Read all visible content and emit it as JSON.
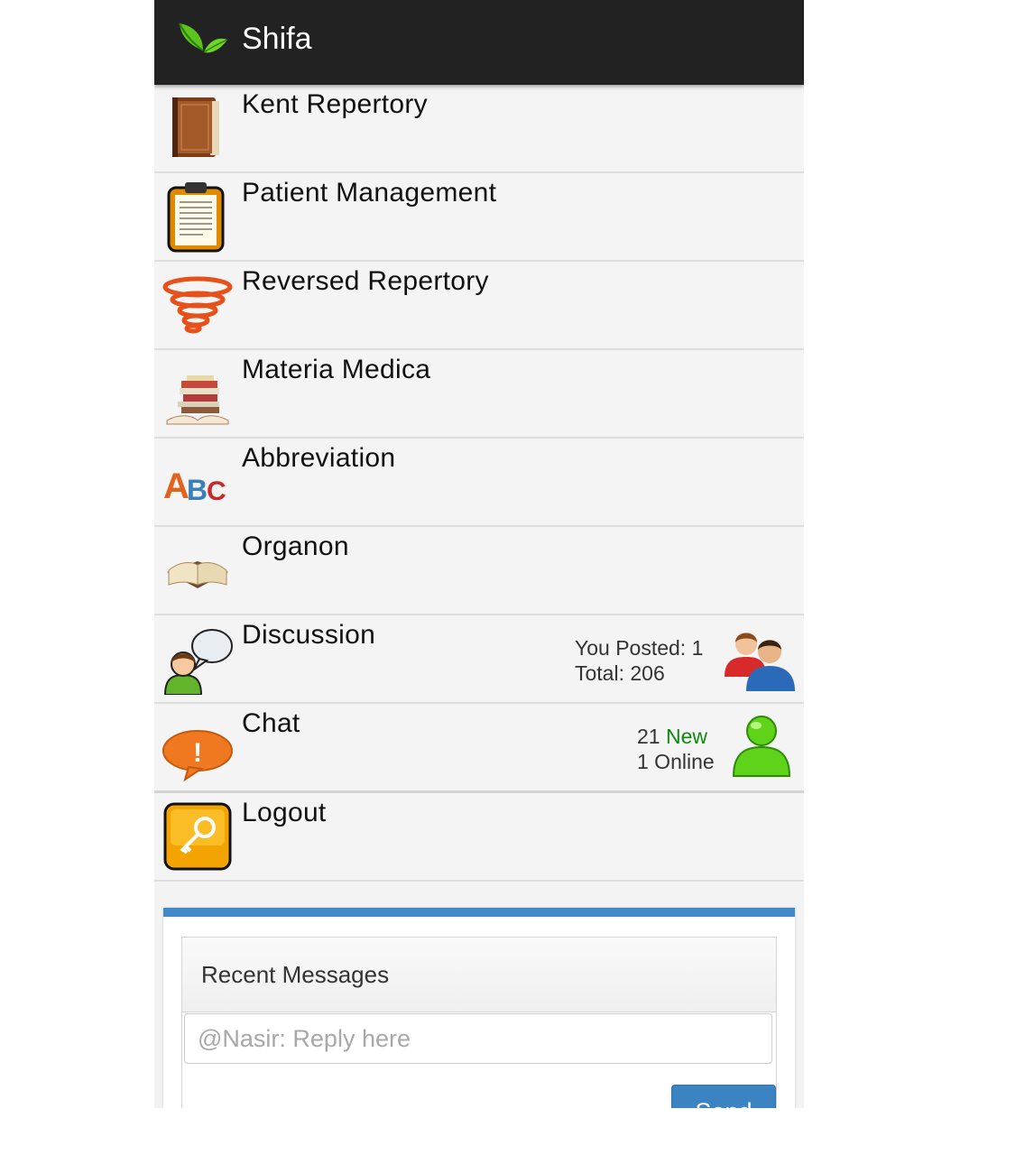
{
  "app": {
    "title": "Shifa"
  },
  "menu": {
    "items": [
      {
        "label": "Kent Repertory",
        "icon": "book-icon"
      },
      {
        "label": "Patient Management",
        "icon": "clipboard-icon"
      },
      {
        "label": "Reversed Repertory",
        "icon": "tornado-icon"
      },
      {
        "label": "Materia Medica",
        "icon": "book-stack-icon"
      },
      {
        "label": "Abbreviation",
        "icon": "abc-icon"
      },
      {
        "label": "Organon",
        "icon": "open-book-icon"
      },
      {
        "label": "Discussion",
        "icon": "discussion-icon"
      },
      {
        "label": "Chat",
        "icon": "chat-bubble-icon"
      },
      {
        "label": "Logout",
        "icon": "key-icon"
      }
    ],
    "discussion": {
      "you_posted": "You Posted: 1",
      "total": "Total: 206",
      "icon": "users-icon"
    },
    "chat": {
      "new_count": "21",
      "new_label": "New",
      "online": "1 Online",
      "icon": "online-user-icon"
    }
  },
  "messages": {
    "title": "Recent Messages",
    "reply_placeholder": "@Nasir: Reply here",
    "send_label": "Send"
  },
  "colors": {
    "actionbar": "#222222",
    "list_bg": "#f4f4f4",
    "accent_blue": "#4189c7",
    "new_green": "#118811"
  }
}
